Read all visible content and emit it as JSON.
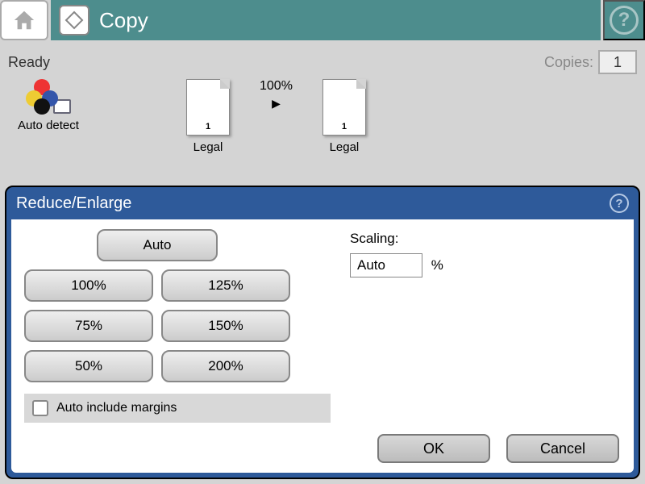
{
  "header": {
    "title": "Copy"
  },
  "status": {
    "ready": "Ready",
    "copies_label": "Copies:",
    "copies_value": "1"
  },
  "preview": {
    "detect_label": "Auto detect",
    "scale_percent": "100%",
    "source": {
      "paper": "Legal",
      "num": "1"
    },
    "dest": {
      "paper": "Legal",
      "num": "1"
    }
  },
  "dialog": {
    "title": "Reduce/Enlarge",
    "presets": {
      "auto": "Auto",
      "p100": "100%",
      "p125": "125%",
      "p75": "75%",
      "p150": "150%",
      "p50": "50%",
      "p200": "200%"
    },
    "scaling": {
      "label": "Scaling:",
      "value": "Auto",
      "unit": "%"
    },
    "auto_margins": "Auto include margins",
    "ok": "OK",
    "cancel": "Cancel"
  }
}
